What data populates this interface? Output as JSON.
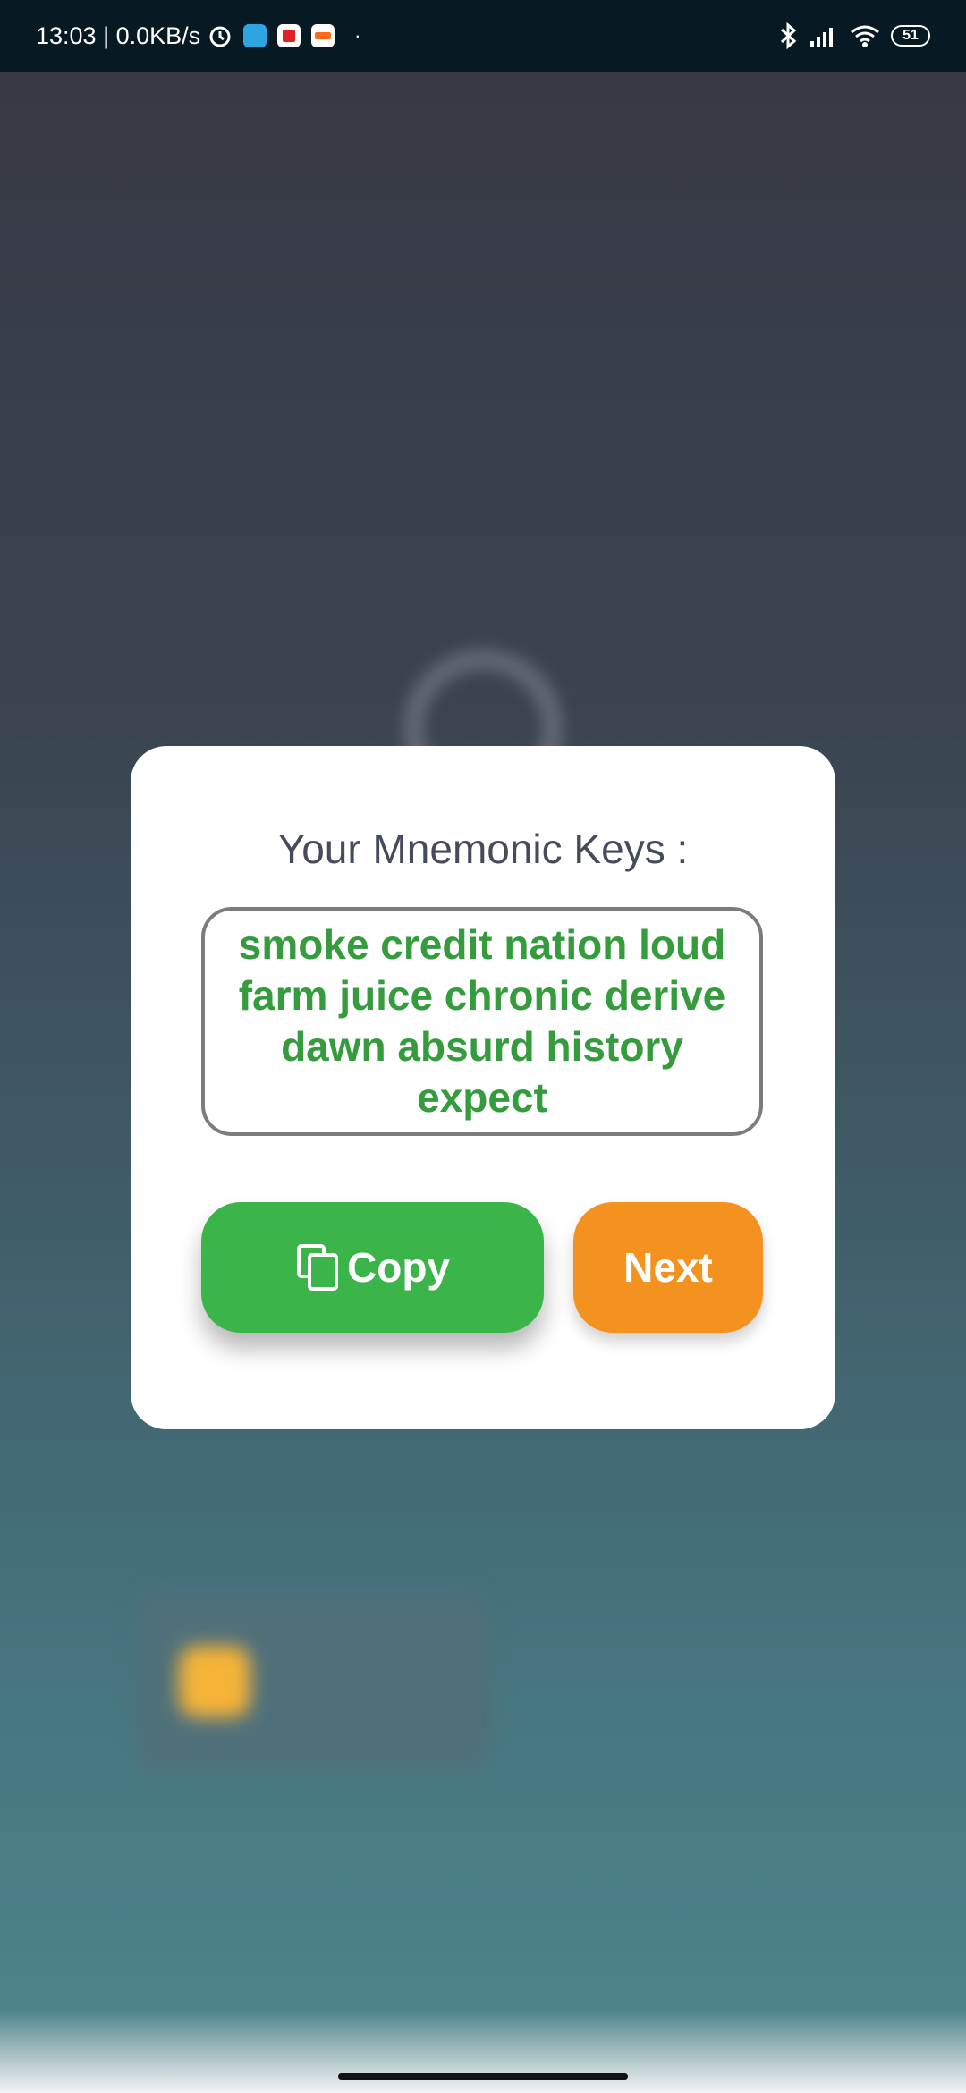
{
  "status_bar": {
    "time_and_speed": "13:03 | 0.0KB/s",
    "dot": "·",
    "battery": "51",
    "icons": [
      "alarm-icon",
      "telegram-icon",
      "app-red-icon",
      "sale-app-icon",
      "bluetooth-icon",
      "signal-icon",
      "wifi-icon",
      "battery-icon"
    ]
  },
  "dialog": {
    "title": "Your Mnemonic Keys :",
    "mnemonic": "smoke credit nation loud farm juice chronic derive dawn absurd history expect",
    "copy_label": "Copy",
    "next_label": "Next"
  },
  "colors": {
    "copy_button": "#3bb54a",
    "next_button": "#f49220",
    "mnemonic_text": "#359c3e",
    "status_bar": "#071a24"
  }
}
